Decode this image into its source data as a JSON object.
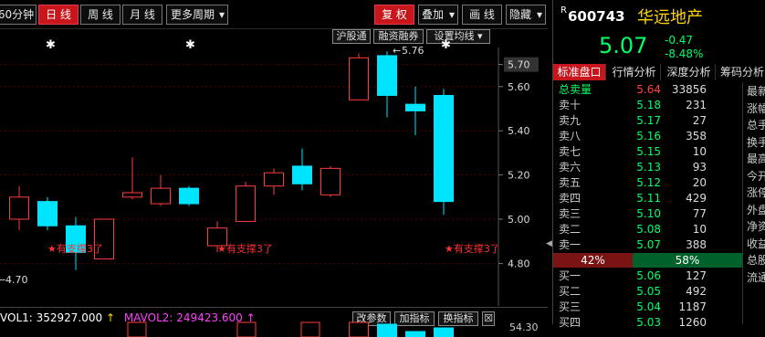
{
  "toolbar": {
    "period": "60分钟",
    "daily": "日 线",
    "weekly": "周 线",
    "monthly": "月 线",
    "more": "更多周期",
    "restore": "复 权",
    "overlay": "叠加",
    "draw": "画 线",
    "hide": "隐藏"
  },
  "chart": {
    "buttons": [
      "沪股通",
      "融资融券",
      "设置均线"
    ],
    "high_label": "5.76",
    "low_label": "4.70",
    "support": "有支撑3了",
    "stars": "✱"
  },
  "chart_data": {
    "type": "candlestick",
    "y_ticks": [
      "5.70",
      "5.60",
      "5.40",
      "5.20",
      "5.00",
      "4.80"
    ],
    "candles": [
      {
        "o": 5.0,
        "c": 5.1,
        "h": 5.15,
        "l": 4.95
      },
      {
        "o": 5.08,
        "c": 4.97,
        "h": 5.1,
        "l": 4.95
      },
      {
        "o": 4.97,
        "c": 4.85,
        "h": 5.01,
        "l": 4.77
      },
      {
        "o": 4.82,
        "c": 5.0,
        "h": 5.0,
        "l": 4.82
      },
      {
        "o": 5.1,
        "c": 5.12,
        "h": 5.28,
        "l": 5.09
      },
      {
        "o": 5.07,
        "c": 5.14,
        "h": 5.2,
        "l": 5.06
      },
      {
        "o": 5.14,
        "c": 5.07,
        "h": 5.15,
        "l": 5.06
      },
      {
        "o": 4.88,
        "c": 4.96,
        "h": 4.99,
        "l": 4.85
      },
      {
        "o": 4.99,
        "c": 5.15,
        "h": 5.17,
        "l": 4.99
      },
      {
        "o": 5.15,
        "c": 5.21,
        "h": 5.23,
        "l": 5.11
      },
      {
        "o": 5.24,
        "c": 5.16,
        "h": 5.32,
        "l": 5.13
      },
      {
        "o": 5.11,
        "c": 5.23,
        "h": 5.24,
        "l": 5.1
      },
      {
        "o": 5.54,
        "c": 5.73,
        "h": 5.75,
        "l": 5.54
      },
      {
        "o": 5.74,
        "c": 5.56,
        "h": 5.76,
        "l": 5.46
      },
      {
        "o": 5.52,
        "c": 5.49,
        "h": 5.6,
        "l": 5.38
      },
      {
        "o": 5.56,
        "c": 5.08,
        "h": 5.59,
        "l": 5.02
      }
    ]
  },
  "vol": {
    "mavol1": "VOL1: 352927.000",
    "mavol2": "MAVOL2: 249423.600",
    "buttons": [
      "改参数",
      "加指标",
      "换指标",
      "☒"
    ],
    "scale": "54.30"
  },
  "stock": {
    "flag": "R",
    "code": "600743",
    "name": "华远地产",
    "price": "5.07",
    "change": "-0.47",
    "pct": "-8.48%"
  },
  "tabs": [
    "标准盘口",
    "行情分析",
    "深度分析",
    "筹码分析"
  ],
  "total_sell": {
    "label": "总卖量",
    "price": "5.64",
    "vol": "33856"
  },
  "asks": [
    {
      "label": "卖十",
      "price": "5.18",
      "vol": "231"
    },
    {
      "label": "卖九",
      "price": "5.17",
      "vol": "27"
    },
    {
      "label": "卖八",
      "price": "5.16",
      "vol": "358"
    },
    {
      "label": "卖七",
      "price": "5.15",
      "vol": "10"
    },
    {
      "label": "卖六",
      "price": "5.13",
      "vol": "93"
    },
    {
      "label": "卖五",
      "price": "5.12",
      "vol": "20"
    },
    {
      "label": "卖四",
      "price": "5.11",
      "vol": "429"
    },
    {
      "label": "卖三",
      "price": "5.10",
      "vol": "77"
    },
    {
      "label": "卖二",
      "price": "5.08",
      "vol": "10"
    },
    {
      "label": "卖一",
      "price": "5.07",
      "vol": "388"
    }
  ],
  "ratio": {
    "left": "42%",
    "right": "58%",
    "left_pct": 42
  },
  "bids": [
    {
      "label": "买一",
      "price": "5.06",
      "vol": "127"
    },
    {
      "label": "买二",
      "price": "5.05",
      "vol": "492"
    },
    {
      "label": "买三",
      "price": "5.04",
      "vol": "1187"
    },
    {
      "label": "买四",
      "price": "5.03",
      "vol": "1260"
    }
  ],
  "side_labels": [
    "最新",
    "涨幅",
    "总手",
    "换手",
    "最高",
    "今开",
    "涨停",
    "外盘",
    "净资",
    "收益",
    "总股",
    "流通"
  ],
  "colors": {
    "rise": "#ff3c3c",
    "fall": "#00e5ff",
    "accent": "#c8161d",
    "price": "#00ff66"
  }
}
